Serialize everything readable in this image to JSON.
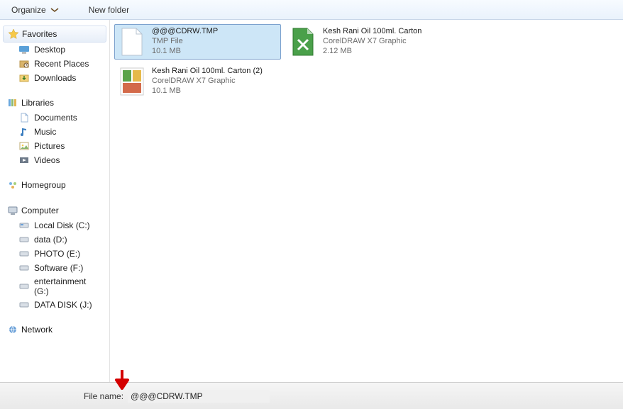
{
  "toolbar": {
    "organize_label": "Organize",
    "newfolder_label": "New folder"
  },
  "nav": {
    "favorites": {
      "header": "Favorites",
      "items": [
        {
          "icon": "desktop-icon",
          "label": "Desktop"
        },
        {
          "icon": "recent-icon",
          "label": "Recent Places"
        },
        {
          "icon": "downloads-icon",
          "label": "Downloads"
        }
      ]
    },
    "libraries": {
      "header": "Libraries",
      "items": [
        {
          "icon": "documents-icon",
          "label": "Documents"
        },
        {
          "icon": "music-icon",
          "label": "Music"
        },
        {
          "icon": "pictures-icon",
          "label": "Pictures"
        },
        {
          "icon": "videos-icon",
          "label": "Videos"
        }
      ]
    },
    "homegroup": {
      "header": "Homegroup"
    },
    "computer": {
      "header": "Computer",
      "items": [
        {
          "icon": "localdisk-icon",
          "label": "Local Disk (C:)"
        },
        {
          "icon": "drive-icon",
          "label": "data  (D:)"
        },
        {
          "icon": "drive-icon",
          "label": "PHOTO (E:)"
        },
        {
          "icon": "drive-icon",
          "label": "Software (F:)"
        },
        {
          "icon": "drive-icon",
          "label": "entertainment (G:)"
        },
        {
          "icon": "drive-icon",
          "label": "DATA DISK (J:)"
        }
      ]
    },
    "network": {
      "header": "Network"
    }
  },
  "files": [
    {
      "selected": true,
      "thumb_kind": "blank-file-icon",
      "name": "@@@CDRW.TMP",
      "type_label": "TMP File",
      "size_label": "10.1 MB"
    },
    {
      "selected": false,
      "thumb_kind": "cdr-file-icon",
      "name": "Kesh Rani Oil 100ml. Carton",
      "type_label": "CorelDRAW X7 Graphic",
      "size_label": "2.12 MB"
    },
    {
      "selected": false,
      "thumb_kind": "cdr-thumb-icon",
      "name": "Kesh Rani Oil 100ml. Carton (2)",
      "type_label": "CorelDRAW X7 Graphic",
      "size_label": "10.1 MB"
    }
  ],
  "footer": {
    "label": "File name:",
    "value": "@@@CDRW.TMP"
  }
}
